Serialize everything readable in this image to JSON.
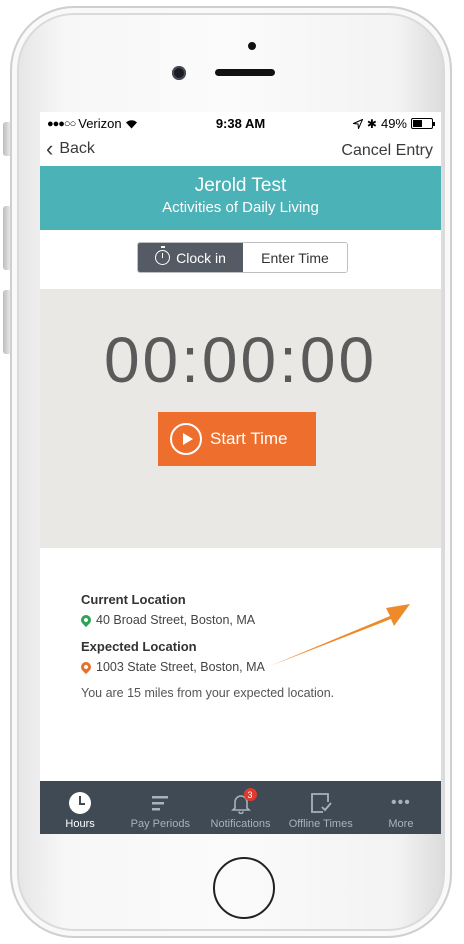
{
  "status_bar": {
    "carrier": "Verizon",
    "time": "9:38 AM",
    "battery": "49%"
  },
  "nav": {
    "back_label": "Back",
    "cancel_label": "Cancel Entry"
  },
  "header": {
    "name": "Jerold Test",
    "activity": "Activities of Daily Living"
  },
  "segment": {
    "clock_in": "Clock in",
    "enter_time": "Enter Time"
  },
  "timer": {
    "value": "00:00:00",
    "start_label": "Start Time"
  },
  "location": {
    "current_label": "Current Location",
    "current_address": "40 Broad Street, Boston, MA",
    "expected_label": "Expected Location",
    "expected_address": "1003 State Street, Boston, MA",
    "distance_message": "You are 15 miles from your expected location."
  },
  "tabs": [
    {
      "label": "Hours",
      "icon": "clock-icon"
    },
    {
      "label": "Pay Periods",
      "icon": "list-icon"
    },
    {
      "label": "Notifications",
      "icon": "bell-icon",
      "badge": "3"
    },
    {
      "label": "Offline Times",
      "icon": "offline-check-icon"
    },
    {
      "label": "More",
      "icon": "more-icon"
    }
  ],
  "colors": {
    "header_teal": "#4bb2b7",
    "accent_orange": "#ee6f2d",
    "tabbar_bg": "#3f4a55",
    "segment_active": "#555b64",
    "timer_bg": "#e9e8e4",
    "pin_green": "#2ea453",
    "pin_orange": "#e8702b"
  }
}
